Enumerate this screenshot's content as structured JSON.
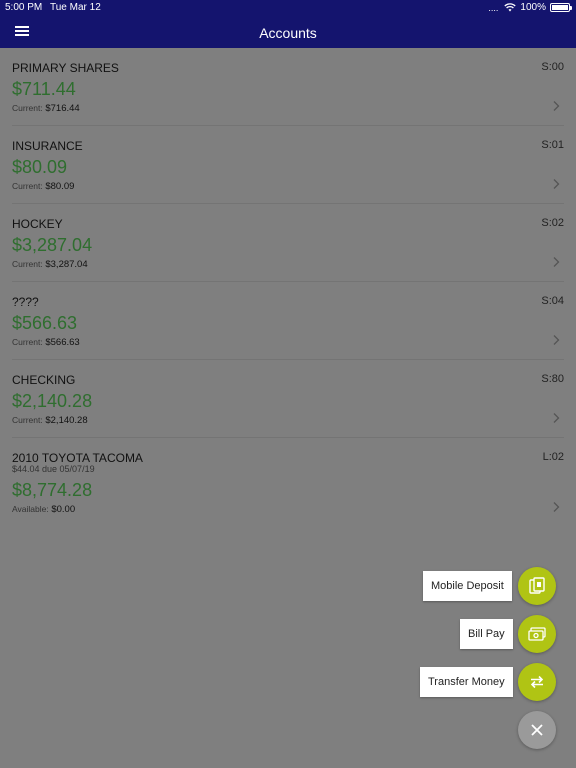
{
  "status_bar": {
    "time": "5:00 PM",
    "date": "Tue Mar 12",
    "signal": "....",
    "battery_text": "100%",
    "battery_level": 1.0
  },
  "header": {
    "title": "Accounts",
    "menu_icon": "hamburger-icon"
  },
  "accounts": [
    {
      "name": "PRIMARY SHARES",
      "id": "S:00",
      "amount": "$711.44",
      "sub_label": "Current:",
      "sub_value": "$716.44"
    },
    {
      "name": "INSURANCE",
      "id": "S:01",
      "amount": "$80.09",
      "sub_label": "Current:",
      "sub_value": "$80.09"
    },
    {
      "name": "HOCKEY",
      "id": "S:02",
      "amount": "$3,287.04",
      "sub_label": "Current:",
      "sub_value": "$3,287.04"
    },
    {
      "name": "????",
      "id": "S:04",
      "amount": "$566.63",
      "sub_label": "Current:",
      "sub_value": "$566.63"
    },
    {
      "name": "CHECKING",
      "id": "S:80",
      "amount": "$2,140.28",
      "sub_label": "Current:",
      "sub_value": "$2,140.28"
    },
    {
      "name": "2010 TOYOTA TACOMA",
      "id": "L:02",
      "due": "$44.04 due 05/07/19",
      "amount": "$8,774.28",
      "sub_label": "Available:",
      "sub_value": "$0.00"
    }
  ],
  "fab_menu": {
    "mobile_deposit": "Mobile Deposit",
    "bill_pay": "Bill Pay",
    "transfer_money": "Transfer Money",
    "accent_color": "#b0c414"
  },
  "colors": {
    "nav": "#14146e",
    "amount": "#2f6e2f"
  }
}
